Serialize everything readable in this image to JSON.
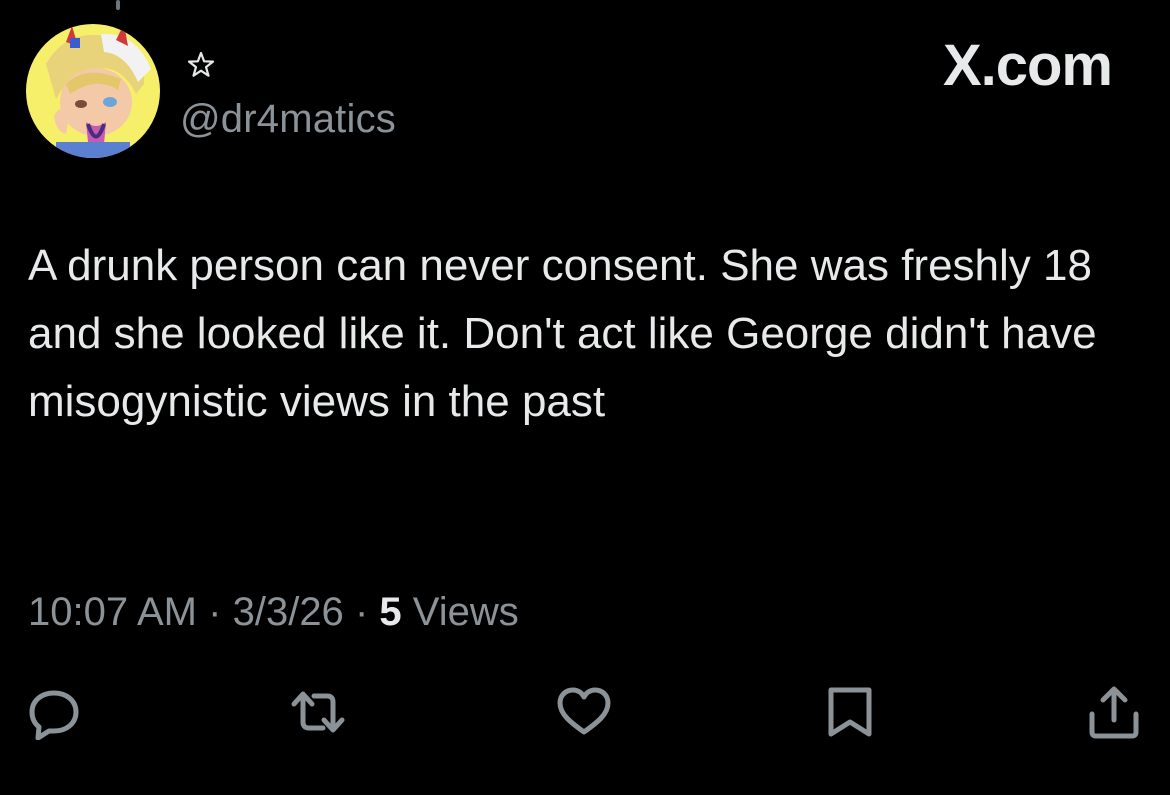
{
  "author": {
    "name_symbol": "☆",
    "handle": "@dr4matics"
  },
  "brand": "X.com",
  "tweet": {
    "text": "A drunk person can never consent. She was freshly 18 and she looked like it. Don't act like George didn't have misogynistic views in the past",
    "time": "10:07 AM",
    "separator": "·",
    "date": "3/3/26",
    "views_count": "5",
    "views_label": "Views"
  },
  "actions": {
    "items": [
      "reply-icon",
      "retweet-icon",
      "like-icon",
      "bookmark-icon",
      "share-icon"
    ]
  },
  "colors": {
    "background": "#000000",
    "text_primary": "#e7e9ea",
    "text_secondary": "#8b9298",
    "icon": "#8b9298",
    "avatar_bg": "#f6ef6a"
  }
}
